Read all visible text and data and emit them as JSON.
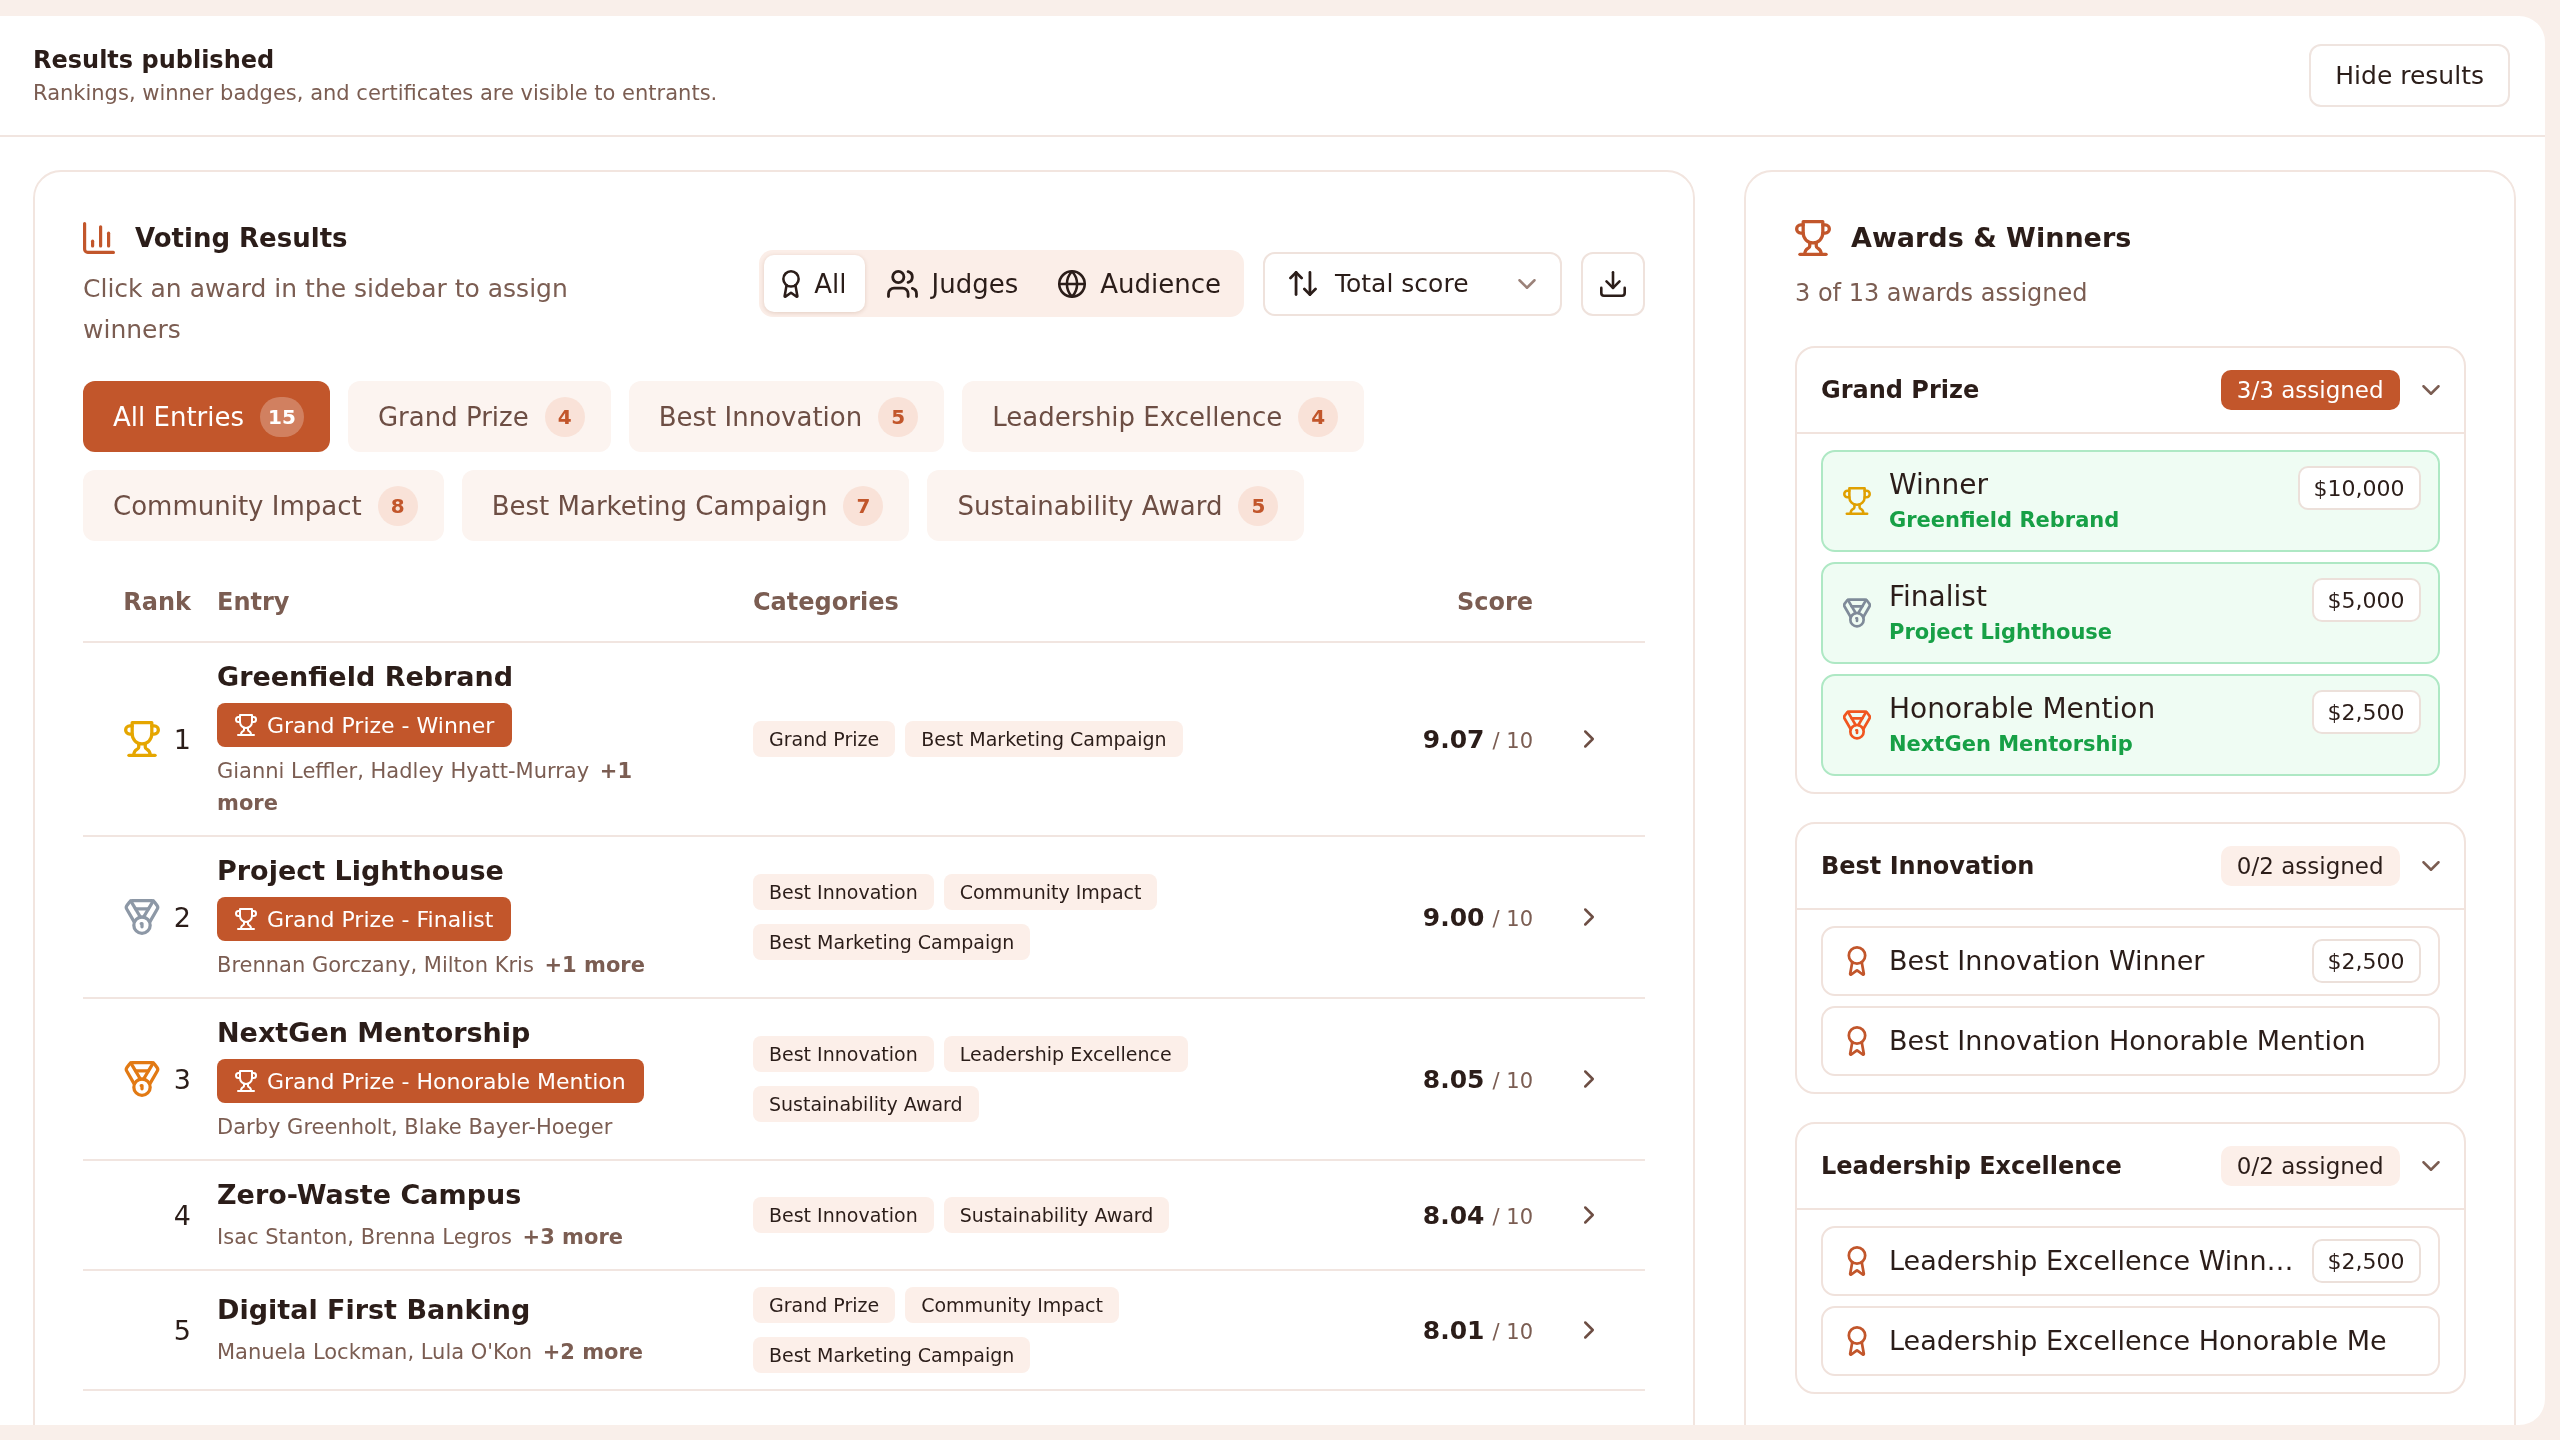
{
  "header": {
    "title": "Results published",
    "subtitle": "Rankings, winner badges, and certificates are visible to entrants.",
    "action": "Hide results"
  },
  "voting": {
    "title": "Voting Results",
    "description": "Click an award in the sidebar to assign winners",
    "source_filter": [
      {
        "label": "All",
        "selected": true
      },
      {
        "label": "Judges",
        "selected": false
      },
      {
        "label": "Audience",
        "selected": false
      }
    ],
    "sort": "Total score",
    "categories": [
      {
        "label": "All Entries",
        "count": "15",
        "selected": true
      },
      {
        "label": "Grand Prize",
        "count": "4",
        "selected": false
      },
      {
        "label": "Best Innovation",
        "count": "5",
        "selected": false
      },
      {
        "label": "Leadership Excellence",
        "count": "4",
        "selected": false
      },
      {
        "label": "Community Impact",
        "count": "8",
        "selected": false
      },
      {
        "label": "Best Marketing Campaign",
        "count": "7",
        "selected": false
      },
      {
        "label": "Sustainability Award",
        "count": "5",
        "selected": false
      }
    ],
    "table": {
      "columns": [
        "Rank",
        "Entry",
        "Categories",
        "Score"
      ],
      "rows": [
        {
          "rank": "1",
          "kind": "trophy",
          "color": "#e5a600",
          "title": "Greenfield Rebrand",
          "award": "Grand Prize - Winner",
          "members": "Gianni Leffler, Hadley Hyatt-Murray **+1 more**",
          "categories": [
            "Grand Prize",
            "Best Marketing Campaign"
          ],
          "score": "9.07",
          "score_max": "/ 10"
        },
        {
          "rank": "2",
          "kind": "medal",
          "color": "#8d98a6",
          "title": "Project Lighthouse",
          "award": "Grand Prize - Finalist",
          "members": "Brennan Gorczany, Milton Kris **+1 more**",
          "categories": [
            "Best Innovation",
            "Community Impact",
            "Best Marketing Campaign"
          ],
          "score": "9.00",
          "score_max": "/ 10"
        },
        {
          "rank": "3",
          "kind": "medal",
          "color": "#e27a14",
          "title": "NextGen Mentorship",
          "award": "Grand Prize - Honorable Mention",
          "members": "Darby Greenholt, Blake Bayer-Hoeger",
          "categories": [
            "Best Innovation",
            "Leadership Excellence",
            "Sustainability Award"
          ],
          "score": "8.05",
          "score_max": "/ 10"
        },
        {
          "rank": "4",
          "kind": "plain",
          "title": "Zero-Waste Campus",
          "members": "Isac Stanton, Brenna Legros **+3 more**",
          "categories": [
            "Best Innovation",
            "Sustainability Award"
          ],
          "score": "8.04",
          "score_max": "/ 10"
        },
        {
          "rank": "5",
          "kind": "plain",
          "title": "Digital First Banking",
          "members": "Manuela Lockman, Lula O'Kon **+2 more**",
          "categories": [
            "Grand Prize",
            "Community Impact",
            "Best Marketing Campaign"
          ],
          "score": "8.01",
          "score_max": "/ 10"
        }
      ]
    }
  },
  "awards": {
    "title": "Awards & Winners",
    "summary": "3 of 13 awards assigned",
    "groups": [
      {
        "name": "Grand Prize",
        "status": "3/3 assigned",
        "complete": true,
        "expanded": true,
        "items": [
          {
            "kind": "trophy",
            "color": "#e0a000",
            "title": "Winner",
            "assigned": true,
            "winner": "Greenfield Rebrand",
            "prize": "$10,000"
          },
          {
            "kind": "medal",
            "color": "#7f8b99",
            "title": "Finalist",
            "assigned": true,
            "winner": "Project Lighthouse",
            "prize": "$5,000"
          },
          {
            "kind": "medal",
            "color": "#f0561f",
            "title": "Honorable Mention",
            "assigned": true,
            "winner": "NextGen Mentorship",
            "prize": "$2,500"
          }
        ]
      },
      {
        "name": "Best Innovation",
        "status": "0/2 assigned",
        "complete": false,
        "expanded": true,
        "items": [
          {
            "kind": "ribbon",
            "color": "#c2562b",
            "title": "Best Innovation Winner",
            "assigned": false,
            "prize": "$2,500"
          },
          {
            "kind": "ribbon",
            "color": "#c2562b",
            "title": "Best Innovation Honorable Mention",
            "assigned": false
          }
        ]
      },
      {
        "name": "Leadership Excellence",
        "status": "0/2 assigned",
        "complete": false,
        "expanded": true,
        "items": [
          {
            "kind": "ribbon",
            "color": "#c2562b",
            "title": "Leadership Excellence Winn…",
            "assigned": false,
            "prize": "$2,500"
          },
          {
            "kind": "ribbon",
            "color": "#c2562b",
            "title": "Leadership Excellence Honorable Me",
            "assigned": false
          }
        ]
      }
    ]
  }
}
